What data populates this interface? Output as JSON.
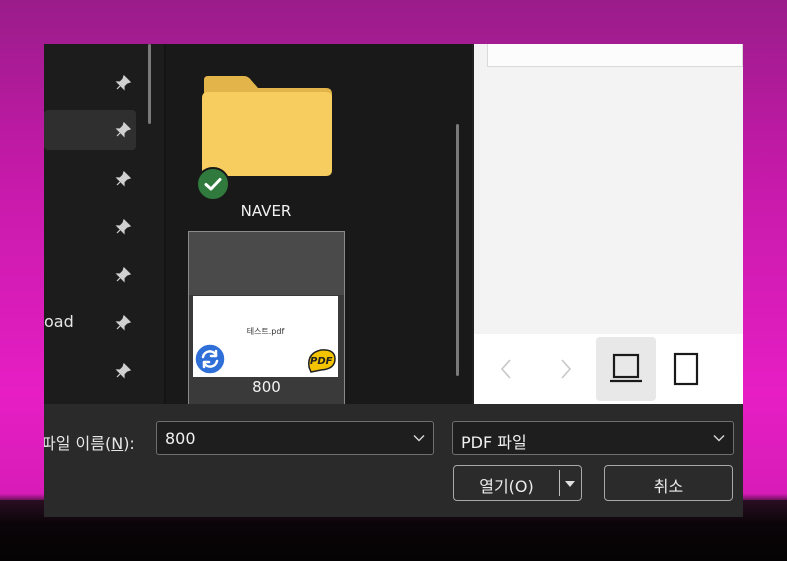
{
  "nav": {
    "items": [
      {
        "label": "",
        "selected": false
      },
      {
        "label": "",
        "selected": true
      },
      {
        "label": "",
        "selected": false
      },
      {
        "label": "",
        "selected": false
      },
      {
        "label": "",
        "selected": false
      },
      {
        "label": "oad",
        "selected": false
      },
      {
        "label": "",
        "selected": false
      }
    ]
  },
  "files": {
    "folder": {
      "name": "NAVER",
      "status_icon": "check-icon"
    },
    "pdf": {
      "name": "800",
      "thumb_text": "테스트.pdf",
      "status_icon": "sync-icon",
      "app_icon": "pdf-logo-icon"
    }
  },
  "footer": {
    "filename_label_prefix": "파일 이름(",
    "filename_label_key": "N",
    "filename_label_suffix": "):",
    "filename_value": "800",
    "filetype_value": "PDF 파일",
    "open_label": "열기(O)",
    "cancel_label": "취소"
  },
  "colors": {
    "accent_bg": "#e61ec4",
    "folder": "#f4c857",
    "check_badge": "#2f7a3c",
    "sync_badge": "#2f6fd8"
  }
}
